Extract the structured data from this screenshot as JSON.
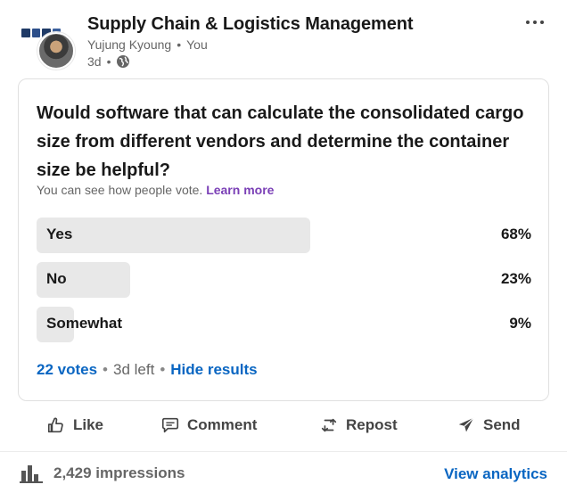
{
  "header": {
    "group_title": "Supply Chain & Logistics Management",
    "author": "Yujung Kyoung",
    "separator": "•",
    "author_role": "You",
    "time": "3d",
    "visibility_icon": "globe-icon",
    "more_icon": "more-options-icon"
  },
  "poll": {
    "question": "Would software that can calculate the consolidated cargo size from different vendors and determine the container size be helpful?",
    "vote_note": "You can see how people vote.",
    "learn_more": "Learn more",
    "options": [
      {
        "label": "Yes",
        "percent_text": "68%",
        "percent": 68
      },
      {
        "label": "No",
        "percent_text": "23%",
        "percent": 23
      },
      {
        "label": "Somewhat",
        "percent_text": "9%",
        "percent": 9
      }
    ],
    "votes": "22 votes",
    "dot": "•",
    "time_left": "3d left",
    "hide_results": "Hide results"
  },
  "actions": {
    "like": "Like",
    "comment": "Comment",
    "repost": "Repost",
    "send": "Send"
  },
  "stats": {
    "impressions": "2,429 impressions",
    "view_analytics": "View analytics"
  },
  "colors": {
    "link_blue": "#0a66c2",
    "learn_more_purple": "#7a3fb6",
    "bar_gray": "#e8e8e8"
  }
}
